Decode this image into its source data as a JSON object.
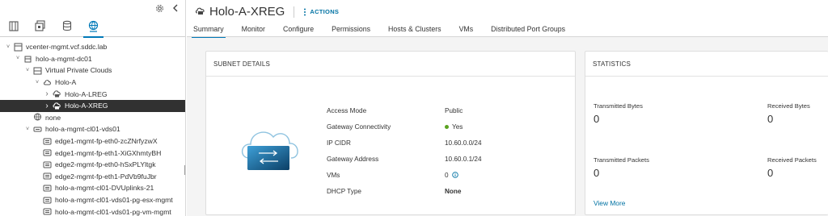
{
  "nav": {
    "tabs": [
      {
        "icon": "hosts-clusters-icon"
      },
      {
        "icon": "vms-templates-icon"
      },
      {
        "icon": "storage-icon"
      },
      {
        "icon": "networking-icon"
      }
    ],
    "tree": [
      {
        "label": "vcenter-mgmt.vcf.sddc.lab",
        "icon": "vcenter-icon",
        "indent": 0,
        "caret": "down"
      },
      {
        "label": "holo-a-mgmt-dc01",
        "icon": "datacenter-icon",
        "indent": 1,
        "caret": "down"
      },
      {
        "label": "Virtual Private Clouds",
        "icon": "vpc-folder-icon",
        "indent": 2,
        "caret": "down"
      },
      {
        "label": "Holo-A",
        "icon": "vpc-icon",
        "indent": 3,
        "caret": "down"
      },
      {
        "label": "Holo-A-LREG",
        "icon": "subnet-icon",
        "indent": 4,
        "caret": "right"
      },
      {
        "label": "Holo-A-XREG",
        "icon": "subnet-icon",
        "indent": 4,
        "caret": "right",
        "selected": true
      },
      {
        "label": "none",
        "icon": "network-icon",
        "indent": 2,
        "caret": ""
      },
      {
        "label": "holo-a-mgmt-cl01-vds01",
        "icon": "dvswitch-icon",
        "indent": 2,
        "caret": "down"
      },
      {
        "label": "edge1-mgmt-fp-eth0-zcZNrfyzwX",
        "icon": "portgroup-icon",
        "indent": 3,
        "caret": ""
      },
      {
        "label": "edge1-mgmt-fp-eth1-XiGXhmtyBH",
        "icon": "portgroup-icon",
        "indent": 3,
        "caret": ""
      },
      {
        "label": "edge2-mgmt-fp-eth0-hSxPLYltgk",
        "icon": "portgroup-icon",
        "indent": 3,
        "caret": ""
      },
      {
        "label": "edge2-mgmt-fp-eth1-PdVb9fuJbr",
        "icon": "portgroup-icon",
        "indent": 3,
        "caret": ""
      },
      {
        "label": "holo-a-mgmt-cl01-DVUplinks-21",
        "icon": "portgroup-icon",
        "indent": 3,
        "caret": ""
      },
      {
        "label": "holo-a-mgmt-cl01-vds01-pg-esx-mgmt",
        "icon": "portgroup-icon",
        "indent": 3,
        "caret": ""
      },
      {
        "label": "holo-a-mgmt-cl01-vds01-pg-vm-mgmt",
        "icon": "portgroup-icon",
        "indent": 3,
        "caret": ""
      }
    ]
  },
  "header": {
    "title": "Holo-A-XREG",
    "actions_label": "ACTIONS",
    "tabs": [
      "Summary",
      "Monitor",
      "Configure",
      "Permissions",
      "Hosts & Clusters",
      "VMs",
      "Distributed Port Groups"
    ],
    "active_tab": "Summary"
  },
  "subnet_details": {
    "title": "SUBNET DETAILS",
    "rows": [
      {
        "key": "Access Mode",
        "value": "Public"
      },
      {
        "key": "Gateway Connectivity",
        "value": "Yes",
        "status": "green"
      },
      {
        "key": "IP CIDR",
        "value": "10.60.0.0/24"
      },
      {
        "key": "Gateway Address",
        "value": "10.60.0.1/24"
      },
      {
        "key": "VMs",
        "value": "0",
        "info": true
      },
      {
        "key": "DHCP Type",
        "value": "None",
        "bold": true
      }
    ]
  },
  "statistics": {
    "title": "STATISTICS",
    "items": [
      {
        "label": "Transmitted Bytes",
        "value": "0"
      },
      {
        "label": "Received Bytes",
        "value": "0"
      },
      {
        "label": "Transmitted Packets",
        "value": "0"
      },
      {
        "label": "Received Packets",
        "value": "0"
      }
    ],
    "view_more": "View More"
  },
  "colors": {
    "accent": "#0079b8",
    "link": "#0072a3",
    "selected_bg": "#313131",
    "status_green": "#5aa220"
  }
}
